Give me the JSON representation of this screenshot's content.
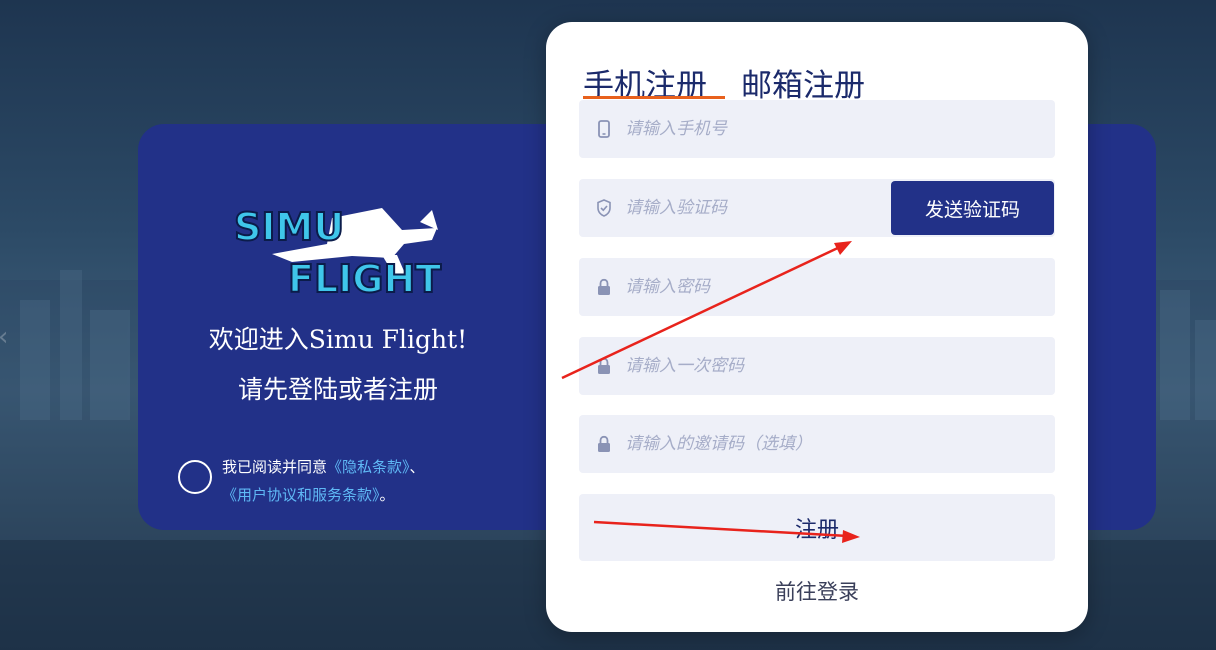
{
  "brand": {
    "logo_text_top": "SIMU",
    "logo_text_bottom": "FLIGHT"
  },
  "welcome": {
    "line1": "欢迎进入Simu Flight!",
    "line2": "请先登陆或者注册"
  },
  "agreement": {
    "prefix": "我已阅读并同意",
    "privacy_link": "《隐私条款》",
    "separator": "、",
    "terms_link": "《用户协议和服务条款》",
    "suffix": "。",
    "checked": false
  },
  "tabs": [
    {
      "label": "手机注册",
      "active": true
    },
    {
      "label": "邮箱注册",
      "active": false
    }
  ],
  "form": {
    "phone_placeholder": "请输入手机号",
    "code_placeholder": "请输入验证码",
    "send_code_label": "发送验证码",
    "password_placeholder": "请输入密码",
    "password_confirm_placeholder": "请输入一次密码",
    "invite_placeholder": "请输入的邀请码（选填）",
    "register_label": "注册",
    "goto_login_label": "前往登录"
  },
  "icons": {
    "phone": "phone-icon",
    "shield": "shield-check-icon",
    "lock": "lock-icon",
    "left_nav": "chevron-left-icon"
  },
  "colors": {
    "panel_blue": "#223188",
    "accent_orange": "#e8611d",
    "link_blue": "#5fb8f5",
    "field_bg": "#eef0f8",
    "annotation_red": "#e8231c"
  }
}
